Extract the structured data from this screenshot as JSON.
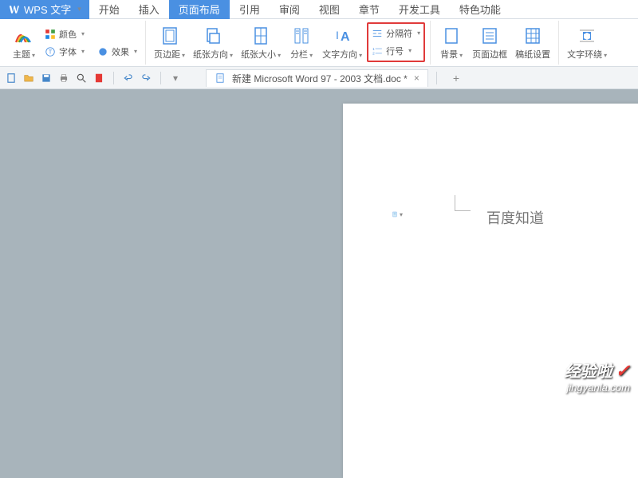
{
  "app": {
    "name": "WPS 文字"
  },
  "tabs": [
    "开始",
    "插入",
    "页面布局",
    "引用",
    "审阅",
    "视图",
    "章节",
    "开发工具",
    "特色功能"
  ],
  "active_tab_index": 2,
  "ribbon": {
    "theme_group": {
      "theme": "主题",
      "color": "颜色",
      "font": "字体",
      "effect": "效果"
    },
    "margins": "页边距",
    "orientation": "纸张方向",
    "size": "纸张大小",
    "columns": "分栏",
    "direction": "文字方向",
    "breaks": "分隔符",
    "line_no": "行号",
    "background": "背景",
    "border": "页面边框",
    "manuscript": "稿纸设置",
    "wrap": "文字环绕"
  },
  "doc_tab": {
    "title": "新建 Microsoft Word 97 - 2003 文档.doc *"
  },
  "page": {
    "text": "百度知道"
  },
  "watermark": {
    "line1": "经验啦",
    "line2": "jingyanla.com"
  }
}
